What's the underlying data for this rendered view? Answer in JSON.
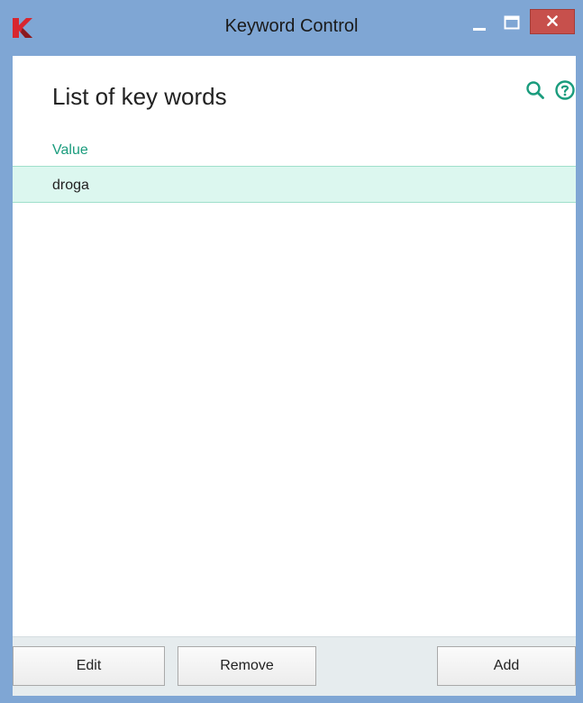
{
  "window": {
    "title": "Keyword Control",
    "accent_color": "#7fa6d4",
    "close_color": "#c7504c",
    "icons": {
      "app": "kaspersky-k-logo",
      "minimize": "minimize-icon",
      "maximize": "maximize-icon",
      "close": "close-icon"
    }
  },
  "toolbar": {
    "icons": [
      "search-icon",
      "help-icon"
    ],
    "icon_color": "#1a9c7d"
  },
  "page": {
    "heading": "List of key words",
    "column_header": "Value",
    "rows": [
      {
        "value": "droga",
        "selected": true
      }
    ]
  },
  "buttons": {
    "edit": "Edit",
    "remove": "Remove",
    "add": "Add"
  }
}
